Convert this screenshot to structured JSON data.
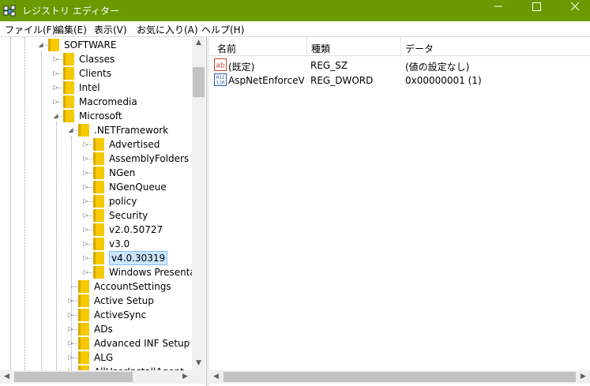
{
  "window": {
    "title": "レジストリ エディター",
    "title_color": "#6a9a00"
  },
  "menu": [
    {
      "label": "ファイル(F)",
      "name": "menu-file"
    },
    {
      "label": "編集(E)",
      "name": "menu-edit"
    },
    {
      "label": "表示(V)",
      "name": "menu-view"
    },
    {
      "label": "お気に入り(A)",
      "name": "menu-favorites"
    },
    {
      "label": "ヘルプ(H)",
      "name": "menu-help"
    }
  ],
  "tree": [
    {
      "label": "SOFTWARE",
      "depth": 0,
      "expander": "expanded"
    },
    {
      "label": "Classes",
      "depth": 1,
      "expander": "collapsed"
    },
    {
      "label": "Clients",
      "depth": 1,
      "expander": "collapsed"
    },
    {
      "label": "Intel",
      "depth": 1,
      "expander": "collapsed"
    },
    {
      "label": "Macromedia",
      "depth": 1,
      "expander": "collapsed"
    },
    {
      "label": "Microsoft",
      "depth": 1,
      "expander": "expanded"
    },
    {
      "label": ".NETFramework",
      "depth": 2,
      "expander": "expanded"
    },
    {
      "label": "Advertised",
      "depth": 3,
      "expander": "collapsed"
    },
    {
      "label": "AssemblyFolders",
      "depth": 3,
      "expander": "collapsed"
    },
    {
      "label": "NGen",
      "depth": 3,
      "expander": "collapsed"
    },
    {
      "label": "NGenQueue",
      "depth": 3,
      "expander": "collapsed"
    },
    {
      "label": "policy",
      "depth": 3,
      "expander": "collapsed"
    },
    {
      "label": "Security",
      "depth": 3,
      "expander": "collapsed"
    },
    {
      "label": "v2.0.50727",
      "depth": 3,
      "expander": "collapsed"
    },
    {
      "label": "v3.0",
      "depth": 3,
      "expander": "collapsed"
    },
    {
      "label": "v4.0.30319",
      "depth": 3,
      "expander": "collapsed",
      "selected": true
    },
    {
      "label": "Windows Presentati",
      "depth": 3,
      "expander": "collapsed"
    },
    {
      "label": "AccountSettings",
      "depth": 2,
      "expander": "none"
    },
    {
      "label": "Active Setup",
      "depth": 2,
      "expander": "collapsed"
    },
    {
      "label": "ActiveSync",
      "depth": 2,
      "expander": "collapsed"
    },
    {
      "label": "ADs",
      "depth": 2,
      "expander": "collapsed"
    },
    {
      "label": "Advanced INF Setup",
      "depth": 2,
      "expander": "collapsed"
    },
    {
      "label": "ALG",
      "depth": 2,
      "expander": "collapsed"
    },
    {
      "label": "AllUserInstallAgent",
      "depth": 2,
      "expander": "collapsed"
    }
  ],
  "columns": [
    "名前",
    "種類",
    "データ"
  ],
  "values": [
    {
      "icon": "string-value-icon",
      "name": "(既定)",
      "type": "REG_SZ",
      "data": "(値の設定なし)"
    },
    {
      "icon": "binary-value-icon",
      "name": "AspNetEnforceV...",
      "type": "REG_DWORD",
      "data": "0x00000001 (1)"
    }
  ]
}
